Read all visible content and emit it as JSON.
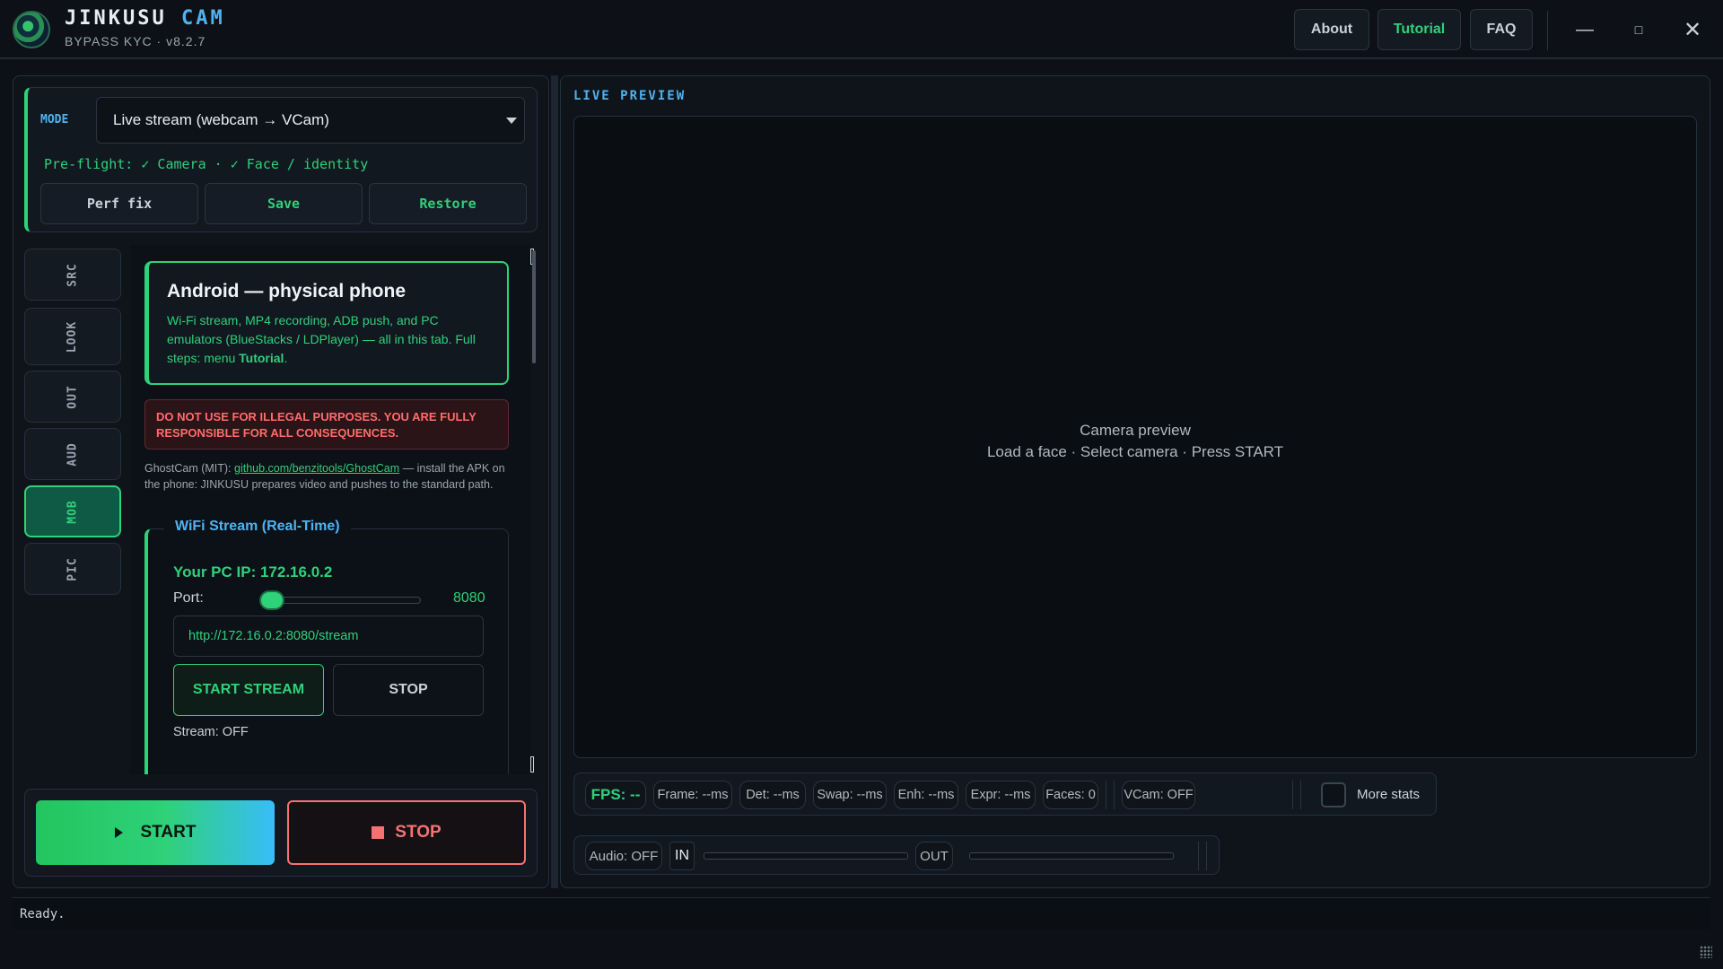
{
  "app": {
    "name_main": "JINKUSU",
    "name_accent": "CAM",
    "subtitle": "BYPASS KYC · v8.2.7"
  },
  "header": {
    "about_label": "About",
    "tutorial_label": "Tutorial",
    "faq_label": "FAQ",
    "minimize_glyph": "—",
    "maximize_glyph": "□",
    "close_glyph": "✕"
  },
  "mode": {
    "label": "MODE",
    "selected": "Live stream (webcam → VCam)",
    "preflight": "Pre-flight: ✓ Camera · ✓ Face / identity",
    "perf_fix_label": "Perf fix",
    "save_label": "Save",
    "restore_label": "Restore"
  },
  "side_tabs": [
    {
      "label": "SRC",
      "active": false
    },
    {
      "label": "LOOK",
      "active": false
    },
    {
      "label": "OUT",
      "active": false
    },
    {
      "label": "AUD",
      "active": false
    },
    {
      "label": "MOB",
      "active": true
    },
    {
      "label": "PIC",
      "active": false
    }
  ],
  "mobile": {
    "card_title": "Android — physical phone",
    "card_desc": "Wi-Fi stream, MP4 recording, ADB push, and PC emulators (BlueStacks / LDPlayer) — all in this tab. Full steps: menu",
    "card_desc_link": "Tutorial",
    "card_desc_end": ".",
    "warning": "DO NOT USE FOR ILLEGAL PURPOSES. YOU ARE FULLY RESPONSIBLE FOR ALL CONSEQUENCES.",
    "ghostcam_prefix": "GhostCam (MIT): ",
    "ghostcam_link": "github.com/benzitools/GhostCam",
    "ghostcam_suffix": " — install the APK on the phone: JINKUSU prepares video and pushes to the standard path.",
    "wifi": {
      "legend": "WiFi Stream (Real-Time)",
      "pc_ip": "Your PC IP: 172.16.0.2",
      "port_label": "Port:",
      "port_value": "8080",
      "url": "http://172.16.0.2:8080/stream",
      "start_label": "START STREAM",
      "stop_label": "STOP",
      "status": "Stream: OFF"
    }
  },
  "run": {
    "start_label": "START",
    "stop_label": "STOP"
  },
  "preview": {
    "label": "LIVE PREVIEW",
    "line1": "Camera preview",
    "line2": "Load a face  ·  Select camera  ·  Press START"
  },
  "stats": {
    "fps": "FPS: --",
    "frame": "Frame: --ms",
    "det": "Det: --ms",
    "swap": "Swap: --ms",
    "enh": "Enh: --ms",
    "expr": "Expr: --ms",
    "faces": "Faces: 0",
    "vcam": "VCam: OFF",
    "more_stats": "More stats"
  },
  "audio": {
    "status": "Audio: OFF",
    "in_label": "IN",
    "out_label": "OUT"
  },
  "status_bar": {
    "text": "Ready."
  },
  "colors": {
    "accent_green": "#2fd17a",
    "accent_blue": "#4fb3f0",
    "danger": "#f87171",
    "background": "#0d1117"
  }
}
